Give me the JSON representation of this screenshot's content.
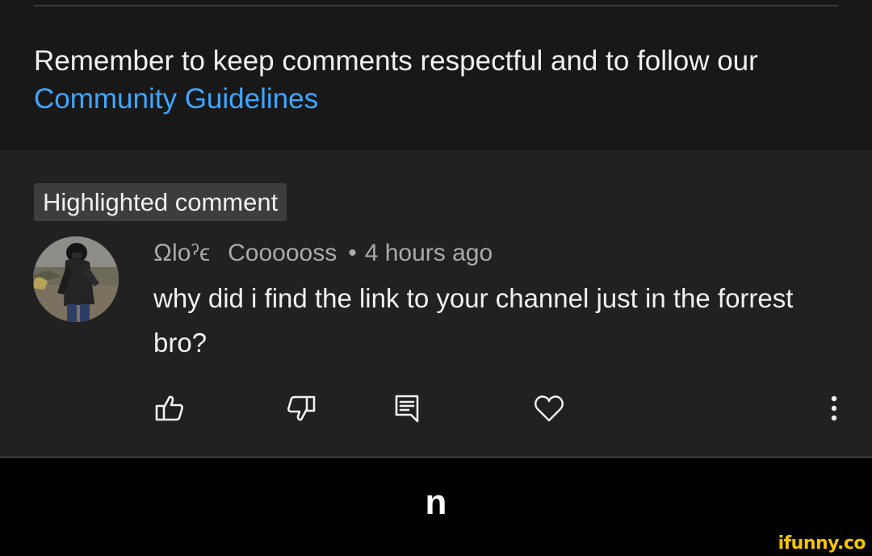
{
  "notice": {
    "text": "Remember to keep comments respectful and to follow our ",
    "link_text": "Community Guidelines"
  },
  "comment": {
    "highlight_label": "Highlighted comment",
    "author_handle": "Ωloˀϵ",
    "author_name": "Coooooss",
    "separator": "•",
    "timestamp": "4 hours ago",
    "text": "why did i find the link to your channel just in the forrest bro?"
  },
  "actions": {
    "like": "like-icon",
    "dislike": "dislike-icon",
    "reply": "reply-icon",
    "heart": "heart-icon",
    "more": "more-vertical-icon"
  },
  "caption": "n",
  "watermark": "ifunny.co",
  "colors": {
    "link": "#3ea6ff",
    "background_top": "#181818",
    "background_comment": "#212121",
    "chip": "#3d3d3d",
    "watermark": "#f5c400"
  }
}
